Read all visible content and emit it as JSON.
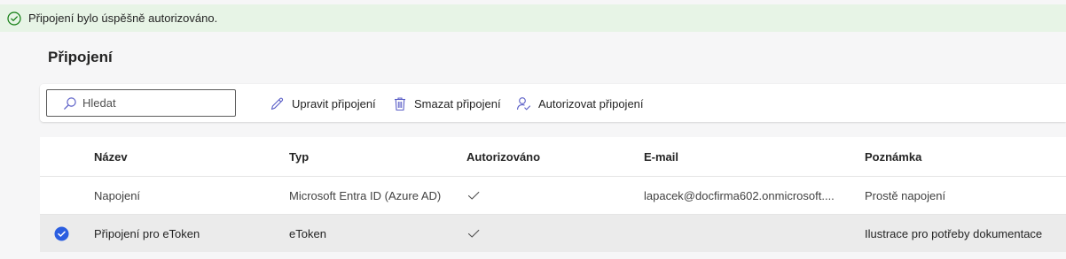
{
  "banner": {
    "message": "Připojení bylo úspěšně autorizováno.",
    "icon": "checkmark-circle-icon",
    "color": "#107c10"
  },
  "page": {
    "title": "Připojení"
  },
  "toolbar": {
    "search_placeholder": "Hledat",
    "search_value": "",
    "edit_label": "Upravit připojení",
    "delete_label": "Smazat připojení",
    "authorize_label": "Autorizovat připojení"
  },
  "table": {
    "columns": {
      "name": "Název",
      "type": "Typ",
      "authorized": "Autorizováno",
      "email": "E-mail",
      "note": "Poznámka"
    },
    "rows": [
      {
        "name": "Napojení",
        "type": "Microsoft Entra ID (Azure AD)",
        "authorized": true,
        "email": "lapacek@docfirma602.onmicrosoft....",
        "note": "Prostě napojení",
        "selected": false
      },
      {
        "name": "Připojení pro eToken",
        "type": "eToken",
        "authorized": true,
        "email": "",
        "note": "Ilustrace pro potřeby dokumentace",
        "selected": true
      }
    ]
  },
  "colors": {
    "accent": "#2b5ee0",
    "success_bg": "#e7f4e6",
    "selected_row": "#ebebeb",
    "icon_purple": "#5b5fc7"
  }
}
